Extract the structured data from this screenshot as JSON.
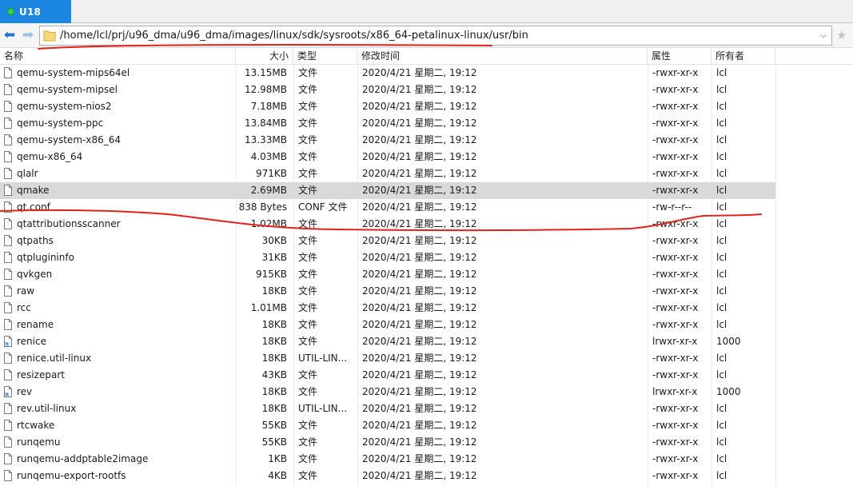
{
  "tab": {
    "label": "U18",
    "status_color": "#39d04a"
  },
  "address": {
    "path": "/home/lcl/prj/u96_dma/u96_dma/images/linux/sdk/sysroots/x86_64-petalinux-linux/usr/bin"
  },
  "columns": {
    "name": "名称",
    "size": "大小",
    "type": "类型",
    "mtime": "修改时间",
    "attr": "属性",
    "owner": "所有者"
  },
  "rows": [
    {
      "name": "qemu-system-mips64el",
      "size": "13.15MB",
      "type": "文件",
      "mtime": "2020/4/21 星期二, 19:12",
      "attr": "-rwxr-xr-x",
      "owner": "lcl",
      "icon": "file-icon"
    },
    {
      "name": "qemu-system-mipsel",
      "size": "12.98MB",
      "type": "文件",
      "mtime": "2020/4/21 星期二, 19:12",
      "attr": "-rwxr-xr-x",
      "owner": "lcl",
      "icon": "file-icon"
    },
    {
      "name": "qemu-system-nios2",
      "size": "7.18MB",
      "type": "文件",
      "mtime": "2020/4/21 星期二, 19:12",
      "attr": "-rwxr-xr-x",
      "owner": "lcl",
      "icon": "file-icon"
    },
    {
      "name": "qemu-system-ppc",
      "size": "13.84MB",
      "type": "文件",
      "mtime": "2020/4/21 星期二, 19:12",
      "attr": "-rwxr-xr-x",
      "owner": "lcl",
      "icon": "file-icon"
    },
    {
      "name": "qemu-system-x86_64",
      "size": "13.33MB",
      "type": "文件",
      "mtime": "2020/4/21 星期二, 19:12",
      "attr": "-rwxr-xr-x",
      "owner": "lcl",
      "icon": "file-icon"
    },
    {
      "name": "qemu-x86_64",
      "size": "4.03MB",
      "type": "文件",
      "mtime": "2020/4/21 星期二, 19:12",
      "attr": "-rwxr-xr-x",
      "owner": "lcl",
      "icon": "file-icon"
    },
    {
      "name": "qlalr",
      "size": "971KB",
      "type": "文件",
      "mtime": "2020/4/21 星期二, 19:12",
      "attr": "-rwxr-xr-x",
      "owner": "lcl",
      "icon": "file-icon"
    },
    {
      "name": "qmake",
      "size": "2.69MB",
      "type": "文件",
      "mtime": "2020/4/21 星期二, 19:12",
      "attr": "-rwxr-xr-x",
      "owner": "lcl",
      "icon": "file-icon",
      "selected": true
    },
    {
      "name": "qt.conf",
      "size": "838 Bytes",
      "type": "CONF 文件",
      "mtime": "2020/4/21 星期二, 19:12",
      "attr": "-rw-r--r--",
      "owner": "lcl",
      "icon": "file-icon"
    },
    {
      "name": "qtattributionsscanner",
      "size": "1.02MB",
      "type": "文件",
      "mtime": "2020/4/21 星期二, 19:12",
      "attr": "-rwxr-xr-x",
      "owner": "lcl",
      "icon": "file-icon"
    },
    {
      "name": "qtpaths",
      "size": "30KB",
      "type": "文件",
      "mtime": "2020/4/21 星期二, 19:12",
      "attr": "-rwxr-xr-x",
      "owner": "lcl",
      "icon": "file-icon"
    },
    {
      "name": "qtplugininfo",
      "size": "31KB",
      "type": "文件",
      "mtime": "2020/4/21 星期二, 19:12",
      "attr": "-rwxr-xr-x",
      "owner": "lcl",
      "icon": "file-icon"
    },
    {
      "name": "qvkgen",
      "size": "915KB",
      "type": "文件",
      "mtime": "2020/4/21 星期二, 19:12",
      "attr": "-rwxr-xr-x",
      "owner": "lcl",
      "icon": "file-icon"
    },
    {
      "name": "raw",
      "size": "18KB",
      "type": "文件",
      "mtime": "2020/4/21 星期二, 19:12",
      "attr": "-rwxr-xr-x",
      "owner": "lcl",
      "icon": "file-icon"
    },
    {
      "name": "rcc",
      "size": "1.01MB",
      "type": "文件",
      "mtime": "2020/4/21 星期二, 19:12",
      "attr": "-rwxr-xr-x",
      "owner": "lcl",
      "icon": "file-icon"
    },
    {
      "name": "rename",
      "size": "18KB",
      "type": "文件",
      "mtime": "2020/4/21 星期二, 19:12",
      "attr": "-rwxr-xr-x",
      "owner": "lcl",
      "icon": "file-icon"
    },
    {
      "name": "renice",
      "size": "18KB",
      "type": "文件",
      "mtime": "2020/4/21 星期二, 19:12",
      "attr": "lrwxr-xr-x",
      "owner": "1000",
      "icon": "symlink-file-icon"
    },
    {
      "name": "renice.util-linux",
      "size": "18KB",
      "type": "UTIL-LIN...",
      "mtime": "2020/4/21 星期二, 19:12",
      "attr": "-rwxr-xr-x",
      "owner": "lcl",
      "icon": "file-icon"
    },
    {
      "name": "resizepart",
      "size": "43KB",
      "type": "文件",
      "mtime": "2020/4/21 星期二, 19:12",
      "attr": "-rwxr-xr-x",
      "owner": "lcl",
      "icon": "file-icon"
    },
    {
      "name": "rev",
      "size": "18KB",
      "type": "文件",
      "mtime": "2020/4/21 星期二, 19:12",
      "attr": "lrwxr-xr-x",
      "owner": "1000",
      "icon": "symlink-file-icon"
    },
    {
      "name": "rev.util-linux",
      "size": "18KB",
      "type": "UTIL-LIN...",
      "mtime": "2020/4/21 星期二, 19:12",
      "attr": "-rwxr-xr-x",
      "owner": "lcl",
      "icon": "file-icon"
    },
    {
      "name": "rtcwake",
      "size": "55KB",
      "type": "文件",
      "mtime": "2020/4/21 星期二, 19:12",
      "attr": "-rwxr-xr-x",
      "owner": "lcl",
      "icon": "file-icon"
    },
    {
      "name": "runqemu",
      "size": "55KB",
      "type": "文件",
      "mtime": "2020/4/21 星期二, 19:12",
      "attr": "-rwxr-xr-x",
      "owner": "lcl",
      "icon": "file-icon"
    },
    {
      "name": "runqemu-addptable2image",
      "size": "1KB",
      "type": "文件",
      "mtime": "2020/4/21 星期二, 19:12",
      "attr": "-rwxr-xr-x",
      "owner": "lcl",
      "icon": "file-icon"
    },
    {
      "name": "runqemu-export-rootfs",
      "size": "4KB",
      "type": "文件",
      "mtime": "2020/4/21 星期二, 19:12",
      "attr": "-rwxr-xr-x",
      "owner": "lcl",
      "icon": "file-icon"
    }
  ],
  "colors": {
    "tab_active": "#1b87e0",
    "selection": "#d9d9d9",
    "annotation": "#e0231d"
  }
}
